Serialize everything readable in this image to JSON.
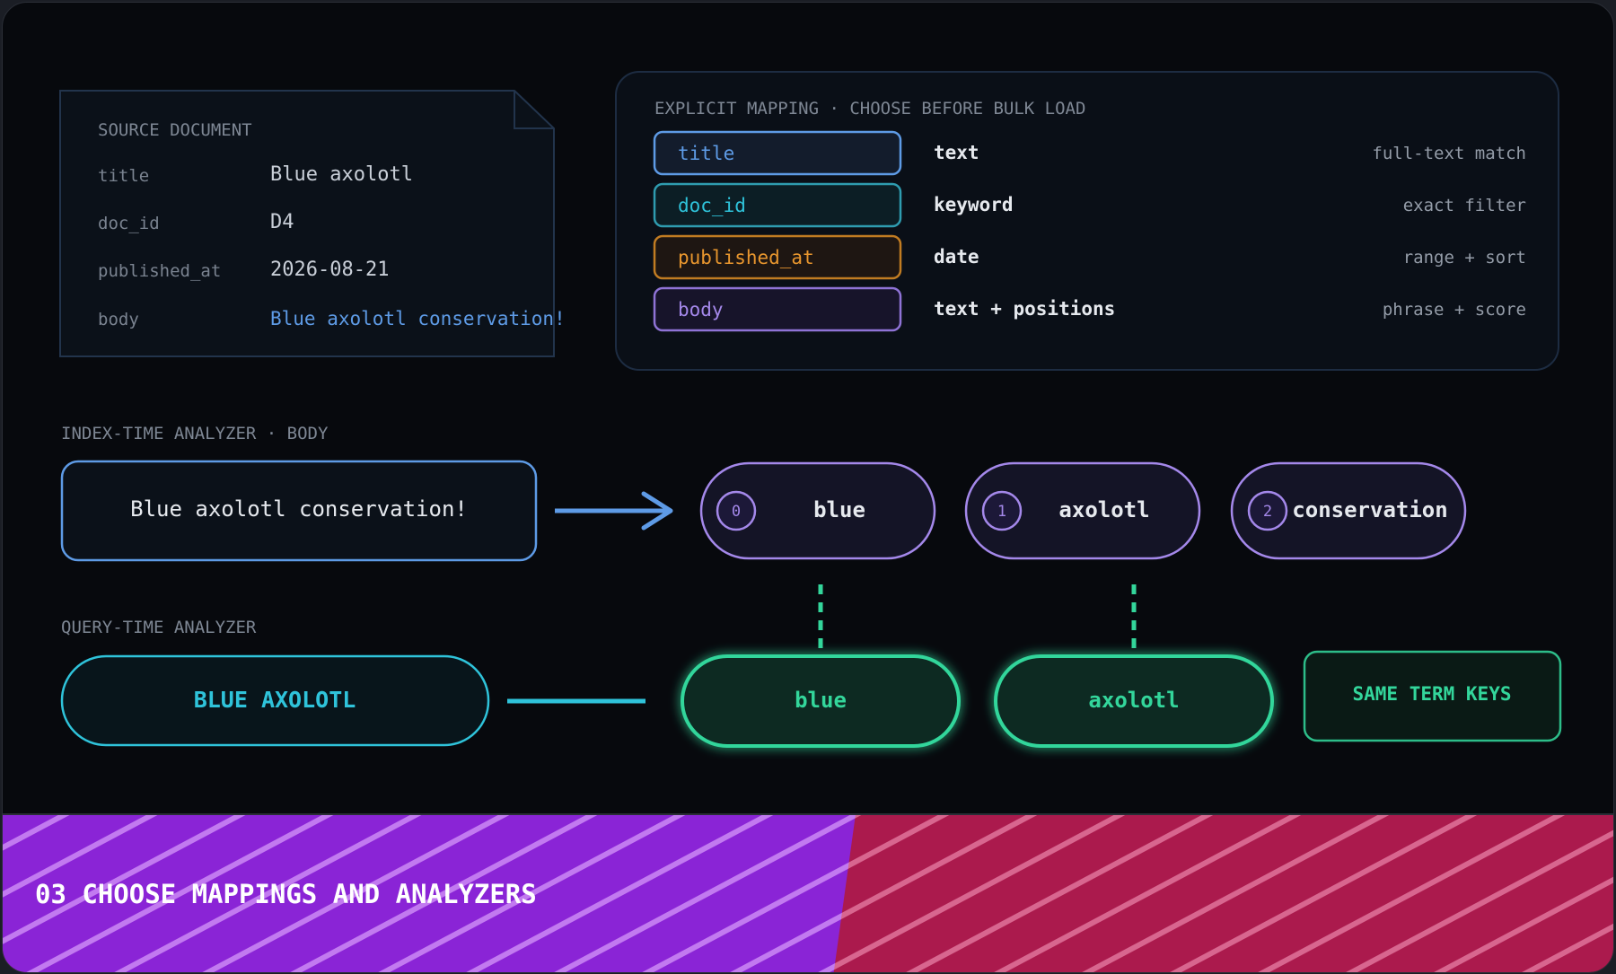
{
  "source": {
    "heading": "SOURCE DOCUMENT",
    "fields": [
      {
        "key": "title",
        "value": "Blue axolotl"
      },
      {
        "key": "doc_id",
        "value": "D4"
      },
      {
        "key": "published_at",
        "value": "2026-08-21"
      },
      {
        "key": "body",
        "value": "Blue axolotl conservation!"
      }
    ]
  },
  "mapping": {
    "heading": "EXPLICIT MAPPING · CHOOSE BEFORE BULK LOAD",
    "rows": [
      {
        "field": "title",
        "type": "text",
        "purpose": "full-text match",
        "color": "#5e9be6"
      },
      {
        "field": "doc_id",
        "type": "keyword",
        "purpose": "exact filter",
        "color": "#2fc3da"
      },
      {
        "field": "published_at",
        "type": "date",
        "purpose": "range + sort",
        "color": "#e8962e"
      },
      {
        "field": "body",
        "type": "text + positions",
        "purpose": "phrase + score",
        "color": "#a488ea"
      }
    ]
  },
  "index_analyzer": {
    "heading": "INDEX-TIME ANALYZER · BODY",
    "input": "Blue axolotl conservation!",
    "tokens": [
      {
        "pos": "0",
        "term": "blue"
      },
      {
        "pos": "1",
        "term": "axolotl"
      },
      {
        "pos": "2",
        "term": "conservation"
      }
    ]
  },
  "query_analyzer": {
    "heading": "QUERY-TIME ANALYZER",
    "input": "BLUE AXOLOTL",
    "tokens": [
      "blue",
      "axolotl"
    ],
    "badge": "SAME TERM KEYS"
  },
  "footer": {
    "title": "03 CHOOSE MAPPINGS AND ANALYZERS"
  },
  "colors": {
    "index_blue": "#5e9be6",
    "token_purple": "#a488ea",
    "query_cyan": "#2fc3da",
    "match_green": "#33d69b",
    "footer_purple": "#8a24d6",
    "footer_red": "#ab1a4d"
  }
}
